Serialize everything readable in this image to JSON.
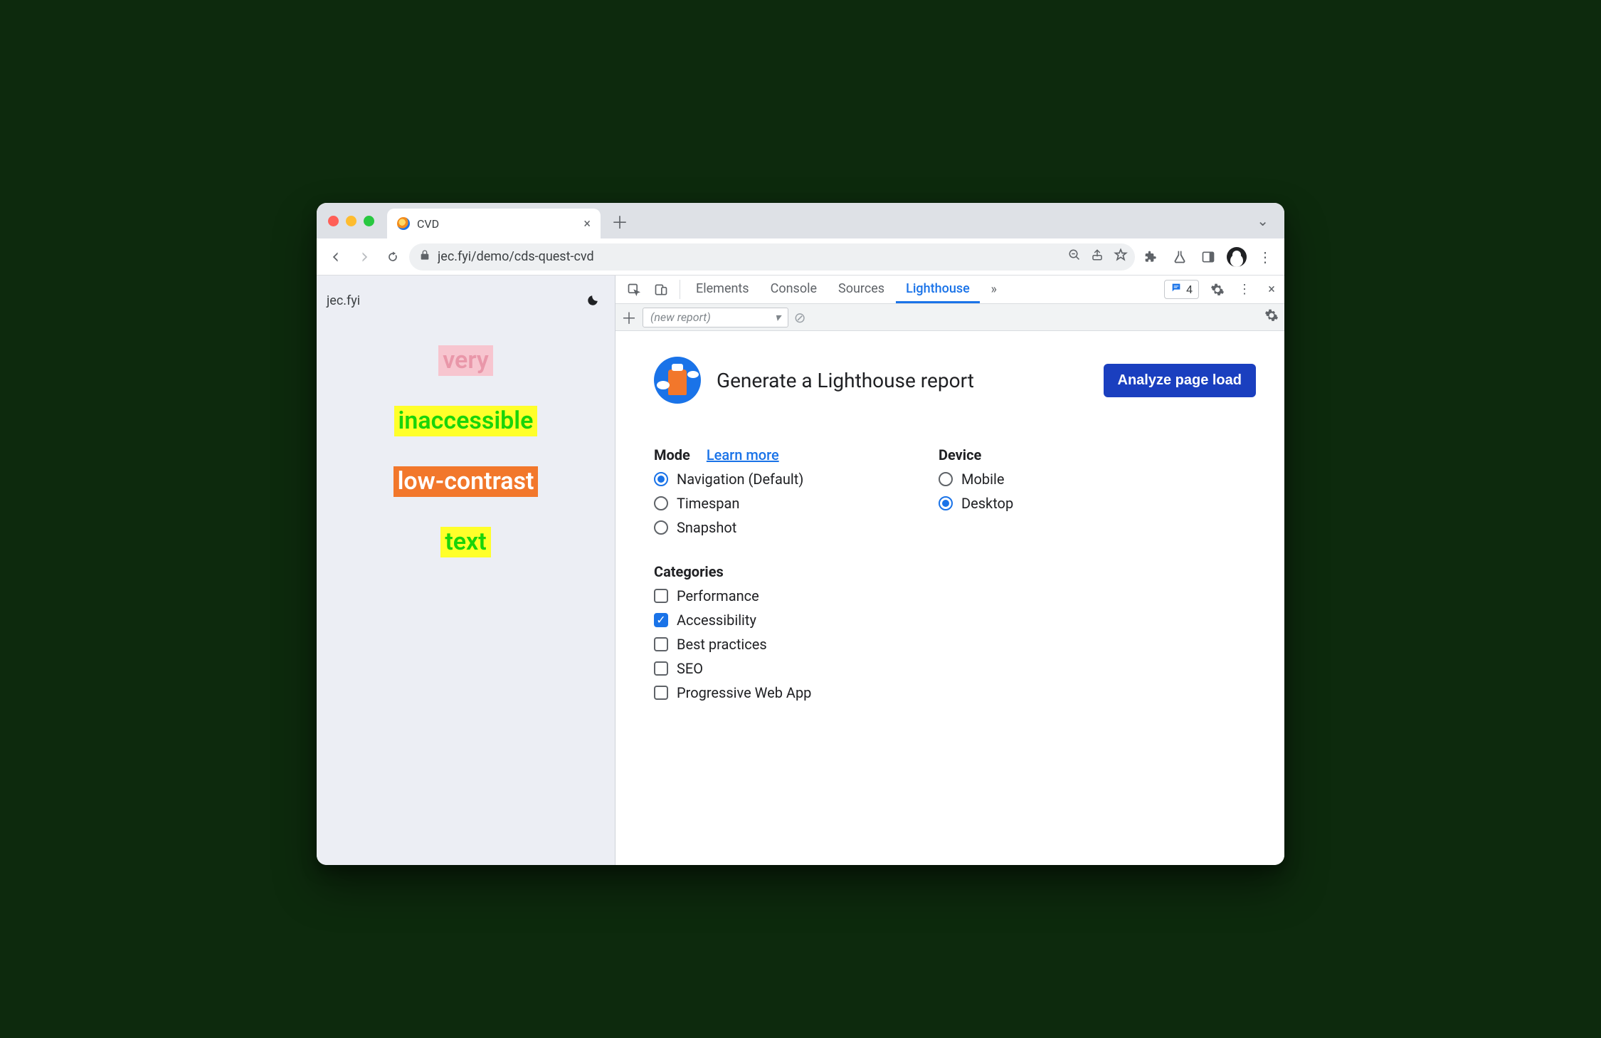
{
  "browser": {
    "tab_title": "CVD",
    "url": "jec.fyi/demo/cds-quest-cvd"
  },
  "page": {
    "brand": "jec.fyi",
    "words": [
      "very",
      "inaccessible",
      "low-contrast",
      "text"
    ]
  },
  "devtools": {
    "tabs": [
      "Elements",
      "Console",
      "Sources",
      "Lighthouse"
    ],
    "active_tab": "Lighthouse",
    "issues_count": "4",
    "report_placeholder": "(new report)"
  },
  "lighthouse": {
    "title": "Generate a Lighthouse report",
    "analyze_label": "Analyze page load",
    "mode_label": "Mode",
    "learn_more": "Learn more",
    "modes": [
      {
        "label": "Navigation (Default)",
        "selected": true
      },
      {
        "label": "Timespan",
        "selected": false
      },
      {
        "label": "Snapshot",
        "selected": false
      }
    ],
    "device_label": "Device",
    "devices": [
      {
        "label": "Mobile",
        "selected": false
      },
      {
        "label": "Desktop",
        "selected": true
      }
    ],
    "categories_label": "Categories",
    "categories": [
      {
        "label": "Performance",
        "checked": false
      },
      {
        "label": "Accessibility",
        "checked": true
      },
      {
        "label": "Best practices",
        "checked": false
      },
      {
        "label": "SEO",
        "checked": false
      },
      {
        "label": "Progressive Web App",
        "checked": false
      }
    ]
  }
}
